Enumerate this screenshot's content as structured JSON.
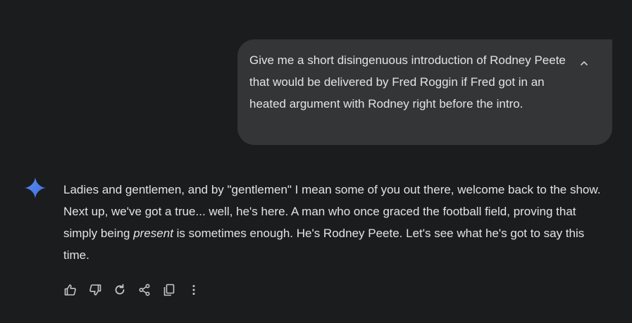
{
  "user_prompt": {
    "text": "Give me a short disingenuous introduction of Rodney Peete that would be delivered by Fred Roggin if Fred got in an heated argument with Rodney right before the intro.",
    "collapse_icon": "chevron-up-icon"
  },
  "response": {
    "avatar_icon": "gemini-sparkle-icon",
    "text_before_italic": "Ladies and gentlemen, and by \"gentlemen\" I mean some of you out there, welcome back to the show. Next up, we've got a true... well, he's here. A man who once graced the football field, proving that simply being ",
    "text_italic": "present",
    "text_after_italic": " is sometimes enough. He's Rodney Peete. Let's see what he's got to say this time."
  },
  "actions": [
    {
      "name": "thumbs-up-icon"
    },
    {
      "name": "thumbs-down-icon"
    },
    {
      "name": "regenerate-icon"
    },
    {
      "name": "share-icon"
    },
    {
      "name": "copy-icon"
    },
    {
      "name": "more-options-icon"
    }
  ],
  "colors": {
    "background": "#1b1c1d",
    "bubble": "#333537",
    "text": "#e3e3e3",
    "icon": "#c4c7c5",
    "sparkle_blue": "#4285f4"
  }
}
